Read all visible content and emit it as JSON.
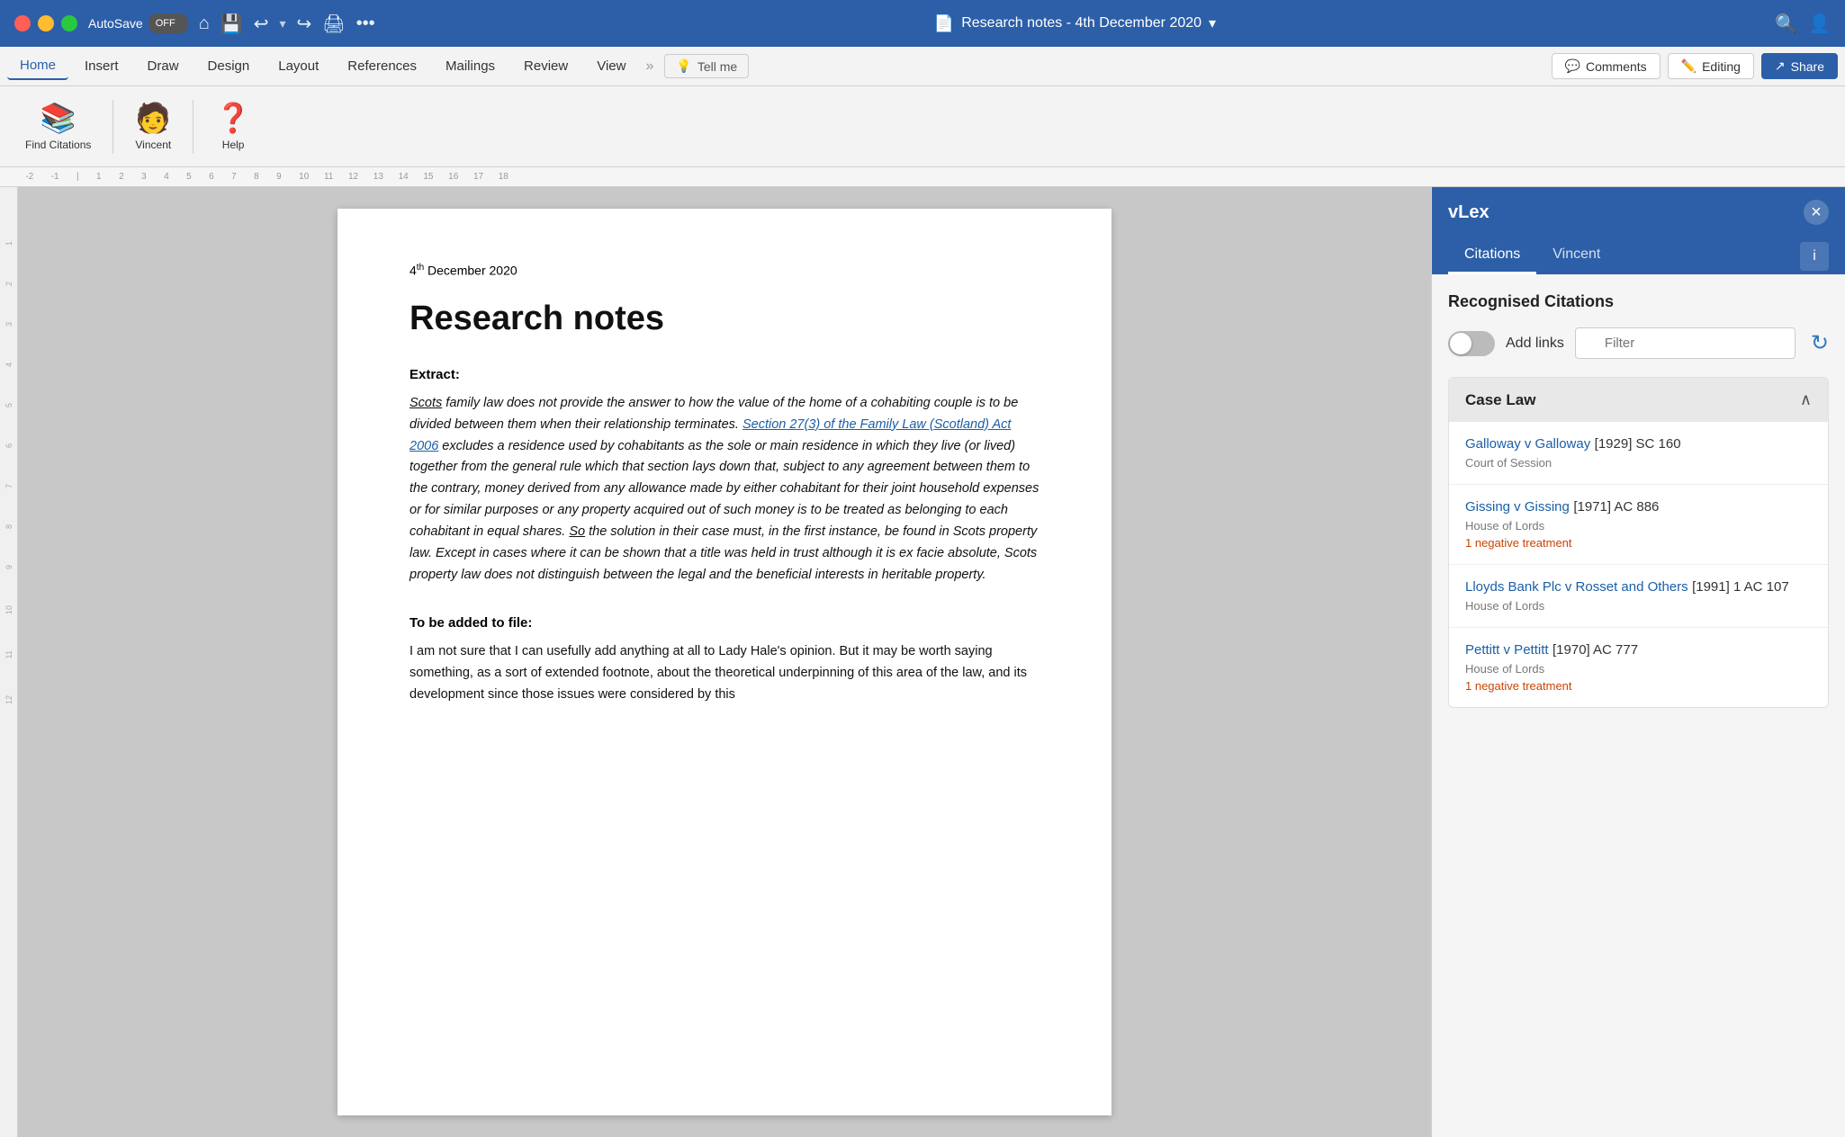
{
  "titlebar": {
    "autosave_label": "AutoSave",
    "autosave_state": "OFF",
    "title": "Research notes - 4th December 2020",
    "icons": [
      "home",
      "save",
      "undo",
      "redo",
      "print",
      "more"
    ]
  },
  "ribbon": {
    "tabs": [
      "Home",
      "Insert",
      "Draw",
      "Design",
      "Layout",
      "References",
      "Mailings",
      "Review",
      "View"
    ],
    "tell_me_placeholder": "Tell me",
    "comments_label": "Comments",
    "editing_label": "Editing",
    "share_label": "Share"
  },
  "toolbar": {
    "find_citations_label": "Find Citations",
    "vincent_label": "Vincent",
    "help_label": "Help"
  },
  "document": {
    "date": "4th December 2020",
    "date_sup": "th",
    "title": "Research notes",
    "extract_heading": "Extract:",
    "extract_body": "Scots family law does not provide the answer to how the value of the home of a cohabiting couple is to be divided between them when their relationship terminates. Section 27(3) of the Family Law (Scotland) Act 2006 excludes a residence used by cohabitants as the sole or main residence in which they live (or lived) together from the general rule which that section lays down that, subject to any agreement between them to the contrary, money derived from any allowance made by either cohabitant for their joint household expenses or for similar purposes or any property acquired out of such money is to be treated as belonging to each cohabitant in equal shares. So the solution in their case must, in the first instance, be found in Scots property law. Except in cases where it can be shown that a title was held in trust although it is ex facie absolute, Scots property law does not distinguish between the legal and the beneficial interests in heritable property.",
    "file_heading": "To be added to file:",
    "file_body": "I am not sure that I can usefully add anything at all to Lady Hale's opinion. But it may be worth saying something, as a sort of extended footnote, about the theoretical underpinning of this area of the law, and its development since those issues were considered by this"
  },
  "vlex": {
    "title": "vLex",
    "close_label": "×",
    "tabs": [
      "Citations",
      "Vincent"
    ],
    "info_label": "i",
    "recognised_title": "Recognised Citations",
    "add_links_label": "Add links",
    "filter_placeholder": "Filter",
    "case_law_title": "Case Law",
    "cases": [
      {
        "name": "Galloway v Galloway",
        "citation": "[1929] SC 160",
        "court": "Court of Session",
        "treatment": null
      },
      {
        "name": "Gissing v Gissing",
        "citation": "[1971] AC 886",
        "court": "House of Lords",
        "treatment": "1 negative treatment"
      },
      {
        "name": "Lloyds Bank Plc v Rosset and Others",
        "citation": "[1991] 1 AC 107",
        "court": "House of Lords",
        "treatment": null
      },
      {
        "name": "Pettitt v Pettitt",
        "citation": "[1970] AC 777",
        "court": "House of Lords",
        "treatment": "1 negative treatment"
      }
    ]
  },
  "colors": {
    "blue": "#2c5fa8",
    "link_blue": "#1a5fa8",
    "negative": "#cc4400"
  }
}
